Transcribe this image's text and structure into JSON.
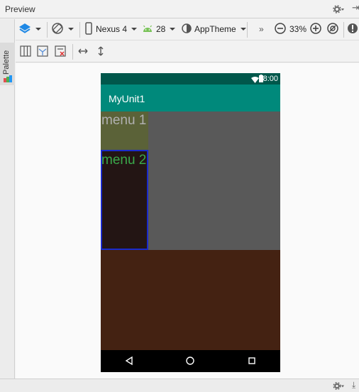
{
  "window": {
    "title": "Preview"
  },
  "palette": {
    "label": "Palette"
  },
  "toolbar": {
    "device": "Nexus 4",
    "api_level": "28",
    "theme": "AppTheme",
    "overflow": "»",
    "zoom": "33%"
  },
  "phone": {
    "status_time": "8:00",
    "app_title": "MyUnit1",
    "menu1_label": "menu 1",
    "menu2_label": "menu 2"
  },
  "colors": {
    "status_bar": "#00574b",
    "app_bar": "#00897b",
    "content_gray": "#595959",
    "menu1_bg": "#5b6238",
    "menu2_bg": "#231514",
    "menu2_text": "#3aa84a",
    "selection_border": "#1a2bcc",
    "bottom_content": "#442212"
  },
  "icons": {
    "design_surface": "layers-icon",
    "orientation": "rotate-icon",
    "device": "phone-icon",
    "api": "android-icon",
    "theme": "theme-icon",
    "zoom_out": "zoom-out-icon",
    "zoom_in": "zoom-in-icon",
    "zoom_fit": "zoom-fit-icon",
    "warning": "warning-icon"
  }
}
